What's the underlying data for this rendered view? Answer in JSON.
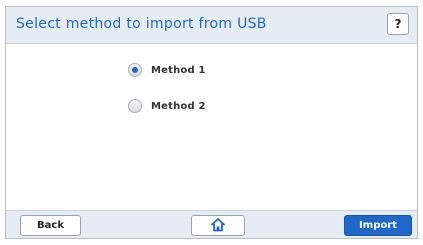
{
  "header": {
    "title": "Select method to import from USB",
    "help_label": "?"
  },
  "options": [
    {
      "label": "Method 1",
      "selected": true
    },
    {
      "label": "Method 2",
      "selected": false
    }
  ],
  "footer": {
    "back_label": "Back",
    "home_icon": "home-icon",
    "import_label": "Import"
  },
  "colors": {
    "accent": "#1f68c9",
    "header_bg": "#e6ecf4"
  }
}
